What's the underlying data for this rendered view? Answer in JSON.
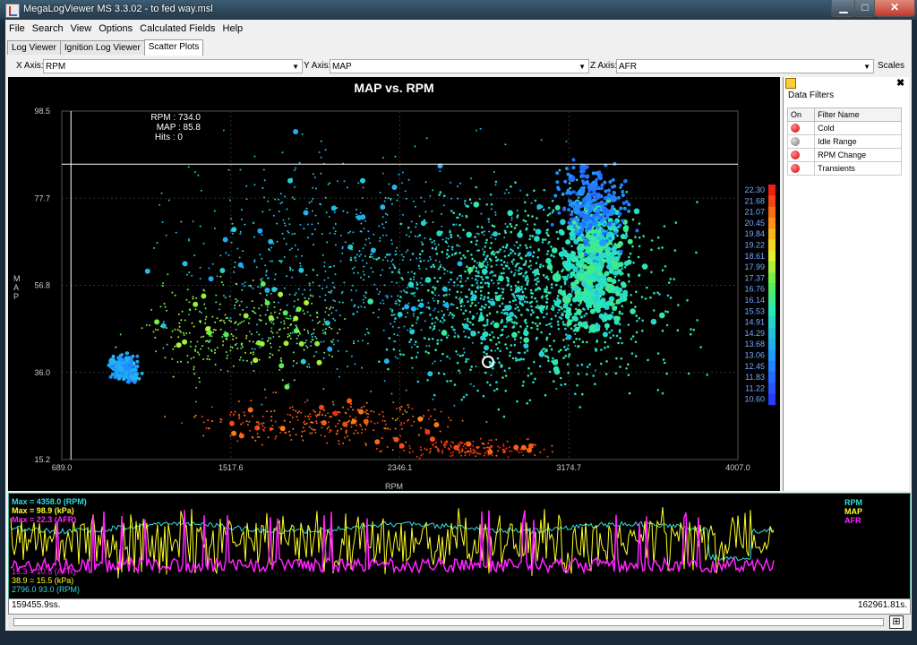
{
  "window": {
    "title": "MegaLogViewer MS 3.3.02 - to fed way.msl"
  },
  "menu": [
    "File",
    "Search",
    "View",
    "Options",
    "Calculated Fields",
    "Help"
  ],
  "tabs": [
    {
      "label": "Log Viewer",
      "active": false
    },
    {
      "label": "Ignition Log Viewer",
      "active": false
    },
    {
      "label": "Scatter Plots",
      "active": true
    }
  ],
  "axes": {
    "x_label": "X Axis:",
    "x_value": "RPM",
    "y_label": "Y Axis:",
    "y_value": "MAP",
    "z_label": "Z Axis:",
    "z_value": "AFR",
    "scales": "Scales"
  },
  "chart_data": {
    "type": "scatter",
    "title": "MAP vs. RPM",
    "xlabel": "RPM",
    "ylabel": "MAP",
    "xlim": [
      689.0,
      4007.0
    ],
    "ylim": [
      15.2,
      98.5
    ],
    "x_ticks": [
      "689.0",
      "1517.6",
      "2346.1",
      "3174.7",
      "4007.0"
    ],
    "y_ticks": [
      "98.5",
      "77.7",
      "56.8",
      "36.0",
      "15.2"
    ],
    "cursor": {
      "rpm": "RPM : 734.0",
      "map": "MAP : 85.8",
      "hits": "Hits : 0"
    },
    "cursor_value": {
      "rpm": 734.0,
      "map": 85.8
    },
    "z_label": "AFR",
    "z_ticks": [
      "22.30",
      "21.68",
      "21.07",
      "20.45",
      "19.84",
      "19.22",
      "18.61",
      "17.99",
      "17.37",
      "16.76",
      "16.14",
      "15.53",
      "14.91",
      "14.29",
      "13.68",
      "13.06",
      "12.45",
      "11.83",
      "11.22",
      "10.60"
    ],
    "zlim": [
      10.6,
      22.3
    ],
    "regions": [
      {
        "rpm": 1000,
        "map": 37,
        "afr": 13.2
      },
      {
        "rpm": 3000,
        "map": 55,
        "afr": 15.6
      },
      {
        "rpm": 3300,
        "map": 60,
        "afr": 15.0
      },
      {
        "rpm": 3300,
        "map": 75,
        "afr": 12.6
      },
      {
        "rpm": 2200,
        "map": 65,
        "afr": 13.6
      },
      {
        "rpm": 2000,
        "map": 22,
        "afr": 21.5
      },
      {
        "rpm": 2600,
        "map": 18,
        "afr": 21.8
      }
    ]
  },
  "filters": {
    "title": "Data Filters",
    "col_on": "On",
    "col_name": "Filter Name",
    "items": [
      {
        "name": "Cold",
        "color": "red"
      },
      {
        "name": "Idle Range",
        "color": "gray"
      },
      {
        "name": "RPM Change",
        "color": "red"
      },
      {
        "name": "Transients",
        "color": "red"
      }
    ]
  },
  "log": {
    "max_lines": [
      "Max = 4358.0 (RPM)",
      "Max = 98.9 (kPa)",
      "Max = 22.3 (AFR)"
    ],
    "min_lines": [
      "15.3 = 10.5 (AFR)",
      "38.9 = 15.5 (kPa)",
      "2796.0 93.0 (RPM)"
    ],
    "legend": [
      "RPM",
      "MAP",
      "AFR"
    ],
    "colors": {
      "rpm": "#33dddd",
      "map": "#ffff22",
      "afr": "#ff22ff"
    },
    "start": "159455.9ss.",
    "end": "162961.81s."
  }
}
